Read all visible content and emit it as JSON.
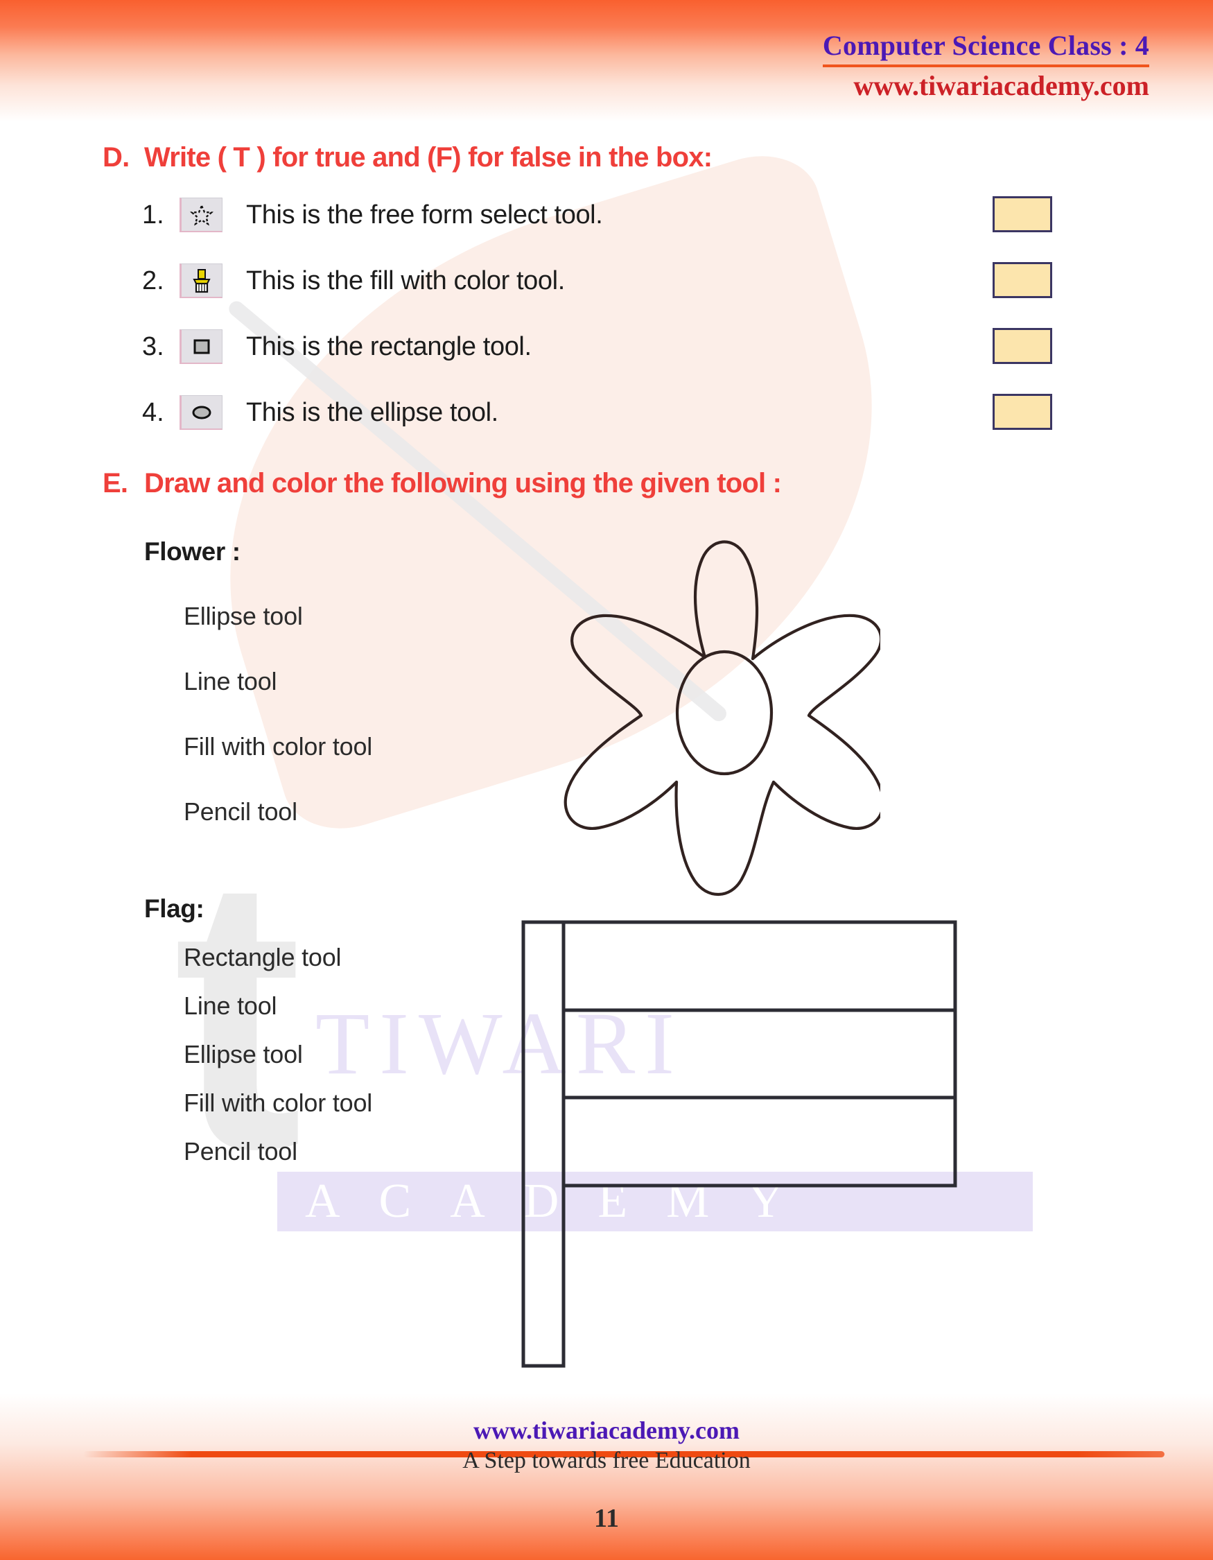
{
  "header": {
    "title": "Computer Science Class : 4",
    "site": "www.tiwariacademy.com"
  },
  "watermark": {
    "letter": "t",
    "brand_line1": "TIWARI",
    "brand_line2": "ACADEMY"
  },
  "sections": [
    {
      "letter": "D.",
      "heading": "Write ( T ) for true and (F) for false in the box:",
      "questions": [
        {
          "number": "1.",
          "icon": "free-form-select-icon",
          "text": "This is the free form select tool."
        },
        {
          "number": "2.",
          "icon": "fill-with-color-icon",
          "text": "This is the fill with color tool."
        },
        {
          "number": "3.",
          "icon": "rectangle-icon",
          "text": "This is the rectangle tool."
        },
        {
          "number": "4.",
          "icon": "ellipse-icon",
          "text": "This is the ellipse tool."
        }
      ]
    },
    {
      "letter": "E.",
      "heading": "Draw and color the following using the given tool :",
      "groups": [
        {
          "title": "Flower :",
          "tools": [
            "Ellipse tool",
            "Line tool",
            "Fill with color tool",
            "Pencil tool"
          ],
          "drawing": "flower-outline"
        },
        {
          "title": "Flag:",
          "tools": [
            "Rectangle tool",
            "Line tool",
            "Ellipse tool",
            "Fill with color tool",
            "Pencil tool"
          ],
          "drawing": "flag-outline"
        }
      ]
    }
  ],
  "footer": {
    "site": "www.tiwariacademy.com",
    "tagline": "A Step towards free Education",
    "page_number": "11"
  },
  "colors": {
    "heading_red": "#ef3f3a",
    "header_purple": "#4b19b5",
    "header_red": "#cc2127",
    "answer_box_fill": "#fce5ad",
    "answer_box_border": "#3b3663",
    "band_orange": "#f8652e",
    "watermark_lavender": "#e8e2f7",
    "watermark_peach": "#fceee8",
    "watermark_grey": "#ebebeb"
  }
}
